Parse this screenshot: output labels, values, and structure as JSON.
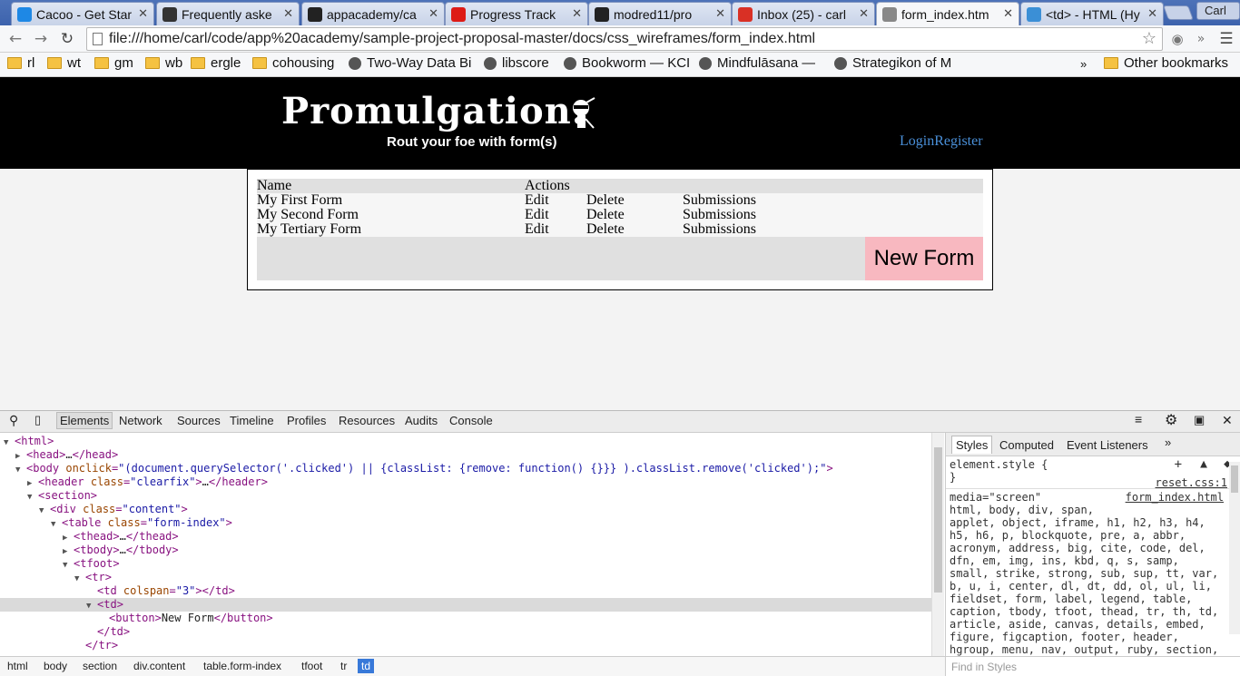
{
  "browser": {
    "tabs": [
      {
        "label": "Cacoo - Get Star",
        "icon": "cacoo-icon",
        "color": "#1e88e5"
      },
      {
        "label": "Frequently aske",
        "icon": "question-icon",
        "color": "#333333"
      },
      {
        "label": "appacademy/ca",
        "icon": "github-icon",
        "color": "#222222"
      },
      {
        "label": "Progress Track",
        "icon": "angular-icon",
        "color": "#dd1b16"
      },
      {
        "label": "modred11/pro",
        "icon": "github-icon",
        "color": "#222222"
      },
      {
        "label": "Inbox (25) - carl",
        "icon": "gmail-icon",
        "color": "#d93025"
      },
      {
        "label": "form_index.htm",
        "icon": "page-icon",
        "color": "#888888"
      },
      {
        "label": "<td> - HTML (Hy",
        "icon": "mdn-icon",
        "color": "#3b8fd6"
      }
    ],
    "user": "Carl",
    "url": "file:///home/carl/code/app%20academy/sample-project-proposal-master/docs/css_wireframes/form_index.html",
    "bookmarks": [
      {
        "label": "rl",
        "type": "folder"
      },
      {
        "label": "wt",
        "type": "folder"
      },
      {
        "label": "gm",
        "type": "folder"
      },
      {
        "label": "wb",
        "type": "folder"
      },
      {
        "label": "ergle",
        "type": "folder"
      },
      {
        "label": "cohousing",
        "type": "folder"
      },
      {
        "label": "Two-Way Data Bi",
        "type": "link"
      },
      {
        "label": "libscore",
        "type": "link"
      },
      {
        "label": "Bookworm — KCI",
        "type": "link"
      },
      {
        "label": "Mindfulāsana —",
        "type": "link"
      },
      {
        "label": "Strategikon of M",
        "type": "link"
      }
    ],
    "bookmarks_overflow": "»",
    "other_bookmarks": "Other bookmarks"
  },
  "site": {
    "logo": "Promulgation.",
    "tagline": "Rout your foe with form(s)",
    "login": "Login",
    "register": "Register",
    "table": {
      "headers": {
        "name": "Name",
        "actions": "Actions"
      },
      "rows": [
        {
          "name": "My First Form",
          "edit": "Edit",
          "delete": "Delete",
          "submissions": "Submissions"
        },
        {
          "name": "My Second Form",
          "edit": "Edit",
          "delete": "Delete",
          "submissions": "Submissions"
        },
        {
          "name": "My Tertiary Form",
          "edit": "Edit",
          "delete": "Delete",
          "submissions": "Submissions"
        }
      ],
      "new_form": "New Form"
    }
  },
  "devtools": {
    "tabs": [
      "Elements",
      "Network",
      "Sources",
      "Timeline",
      "Profiles",
      "Resources",
      "Audits",
      "Console"
    ],
    "active_tab": "Elements",
    "dom_lines": [
      {
        "indent": 0,
        "tri": "▼",
        "html": "<html>"
      },
      {
        "indent": 1,
        "tri": "▶",
        "html": "<head>…</head>"
      },
      {
        "indent": 1,
        "tri": "▼",
        "html": "<body onclick=\"(document.querySelector('.clicked') || {classList: {remove: function() {}}} ).classList.remove('clicked');\">"
      },
      {
        "indent": 2,
        "tri": "▶",
        "html": "<header class=\"clearfix\">…</header>"
      },
      {
        "indent": 2,
        "tri": "▼",
        "html": "<section>"
      },
      {
        "indent": 3,
        "tri": "▼",
        "html": "<div class=\"content\">"
      },
      {
        "indent": 4,
        "tri": "▼",
        "html": "<table class=\"form-index\">"
      },
      {
        "indent": 5,
        "tri": "▶",
        "html": "<thead>…</thead>"
      },
      {
        "indent": 5,
        "tri": "▶",
        "html": "<tbody>…</tbody>"
      },
      {
        "indent": 5,
        "tri": "▼",
        "html": "<tfoot>"
      },
      {
        "indent": 6,
        "tri": "▼",
        "html": "<tr>"
      },
      {
        "indent": 7,
        "tri": "",
        "html": "<td colspan=\"3\"></td>"
      },
      {
        "indent": 7,
        "tri": "▼",
        "html": "<td>",
        "selected": true
      },
      {
        "indent": 8,
        "tri": "",
        "html": "<button>New Form</button>"
      },
      {
        "indent": 7,
        "tri": "",
        "html": "</td>"
      },
      {
        "indent": 6,
        "tri": "",
        "html": "</tr>"
      }
    ],
    "styles_tabs": [
      "Styles",
      "Computed",
      "Event Listeners"
    ],
    "styles_overflow": "»",
    "element_style": "element.style {",
    "element_style_close": "}",
    "media": "media=\"screen\"",
    "source_file": "form_index.html",
    "reset_source": "reset.css:1",
    "selector_lines": [
      "html, body, div, span,",
      "applet, object, iframe, h1, h2, h3, h4,",
      "h5, h6, p, blockquote, pre, a, abbr,",
      "acronym, address, big, cite, code, del,",
      "dfn, em, img, ins, kbd, q, s, samp,",
      "small, strike, strong, sub, sup, tt, var,",
      "b, u, i, center, dl, dt, dd, ol, ul, li,",
      "fieldset, form, label, legend, table,",
      "caption, tbody, tfoot, thead, tr, th, td,",
      "article, aside, canvas, details, embed,",
      "figure, figcaption, footer, header,",
      "hgroup, menu, nav, output, ruby, section,"
    ],
    "find_placeholder": "Find in Styles",
    "breadcrumbs": [
      "html",
      "body",
      "section",
      "div.content",
      "table.form-index",
      "tfoot",
      "tr",
      "td"
    ],
    "active_breadcrumb": "td"
  }
}
